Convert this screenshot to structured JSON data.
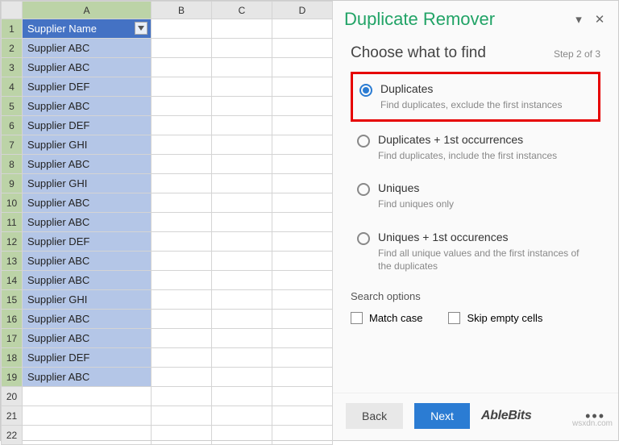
{
  "sheet": {
    "columns": [
      "A",
      "B",
      "C",
      "D"
    ],
    "header_cell": "Supplier Name",
    "rows": [
      "Supplier ABC",
      "Supplier ABC",
      "Supplier DEF",
      "Supplier ABC",
      "Supplier DEF",
      "Supplier GHI",
      "Supplier ABC",
      "Supplier GHI",
      "Supplier ABC",
      "Supplier ABC",
      "Supplier DEF",
      "Supplier ABC",
      "Supplier ABC",
      "Supplier GHI",
      "Supplier ABC",
      "Supplier ABC",
      "Supplier DEF",
      "Supplier ABC"
    ],
    "last_rows": [
      20,
      21,
      22
    ]
  },
  "pane": {
    "title": "Duplicate Remover",
    "step_title": "Choose what to find",
    "step_label": "Step 2 of 3",
    "options": [
      {
        "label": "Duplicates",
        "desc": "Find duplicates, exclude the first instances",
        "selected": true,
        "highlighted": true
      },
      {
        "label": "Duplicates + 1st occurrences",
        "desc": "Find duplicates, include the first instances",
        "selected": false,
        "highlighted": false
      },
      {
        "label": "Uniques",
        "desc": "Find uniques only",
        "selected": false,
        "highlighted": false
      },
      {
        "label": "Uniques + 1st occurences",
        "desc": "Find all unique values and the first instances of the duplicates",
        "selected": false,
        "highlighted": false
      }
    ],
    "search_options_label": "Search options",
    "checkboxes": {
      "match_case": "Match case",
      "skip_empty": "Skip empty cells"
    },
    "buttons": {
      "back": "Back",
      "next": "Next"
    },
    "brand": "AbleBits"
  },
  "watermark": "wsxdn.com"
}
